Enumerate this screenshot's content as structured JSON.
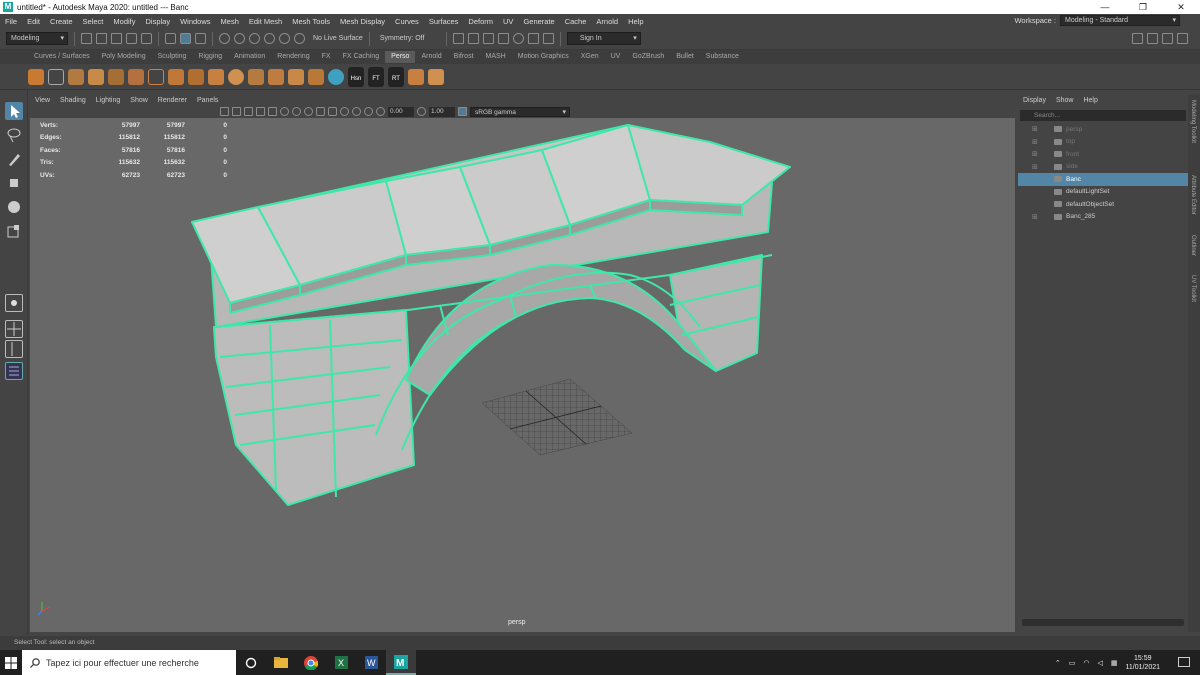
{
  "window": {
    "title": "untitled* - Autodesk Maya 2020: untitled   ---   Banc",
    "minimize": "—",
    "maximize": "❐",
    "close": "✕"
  },
  "menubar": {
    "items": [
      "File",
      "Edit",
      "Create",
      "Select",
      "Modify",
      "Display",
      "Windows",
      "Mesh",
      "Edit Mesh",
      "Mesh Tools",
      "Mesh Display",
      "Curves",
      "Surfaces",
      "Deform",
      "UV",
      "Generate",
      "Cache",
      "Arnold",
      "Help"
    ],
    "workspace_label": "Workspace :",
    "workspace_value": "Modeling - Standard"
  },
  "statusline": {
    "mode": "Modeling",
    "live_surface": "No Live Surface",
    "symmetry": "Symmetry: Off",
    "sign_in": "Sign In"
  },
  "shelf_tabs": {
    "items": [
      "Curves / Surfaces",
      "Poly Modeling",
      "Sculpting",
      "Rigging",
      "Animation",
      "Rendering",
      "FX",
      "FX Caching",
      "Perso",
      "Arnold",
      "Bifrost",
      "MASH",
      "Motion Graphics",
      "XGen",
      "UV",
      "GoZBrush",
      "Bullet",
      "Substance"
    ],
    "active": "Perso"
  },
  "shelf_labels": {
    "a": "Hsn",
    "b": "FT",
    "c": "RT"
  },
  "viewport": {
    "menu": [
      "View",
      "Shading",
      "Lighting",
      "Show",
      "Renderer",
      "Panels"
    ],
    "exposure": "0.00",
    "gamma": "1.00",
    "color_space": "sRGB gamma",
    "camera": "persp"
  },
  "hud": {
    "rows": [
      {
        "label": "Verts:",
        "a": "57997",
        "b": "57997",
        "c": "0"
      },
      {
        "label": "Edges:",
        "a": "115812",
        "b": "115812",
        "c": "0"
      },
      {
        "label": "Faces:",
        "a": "57816",
        "b": "57816",
        "c": "0"
      },
      {
        "label": "Tris:",
        "a": "115632",
        "b": "115632",
        "c": "0"
      },
      {
        "label": "UVs:",
        "a": "62723",
        "b": "62723",
        "c": "0"
      }
    ]
  },
  "outliner": {
    "menu": [
      "Display",
      "Show",
      "Help"
    ],
    "search_placeholder": "Search...",
    "items": [
      {
        "label": "persp",
        "state": "dim"
      },
      {
        "label": "top",
        "state": "dim"
      },
      {
        "label": "front",
        "state": "dim"
      },
      {
        "label": "side",
        "state": "dim"
      },
      {
        "label": "Banc",
        "state": "selected"
      },
      {
        "label": "defaultLightSet",
        "state": "normal"
      },
      {
        "label": "defaultObjectSet",
        "state": "normal"
      },
      {
        "label": "Banc_285",
        "state": "normal"
      }
    ]
  },
  "side_tabs": [
    "Modeling Toolkit",
    "Attribute Editor",
    "Outliner",
    "UV Toolkit"
  ],
  "help_line": "Select Tool: select an object",
  "taskbar": {
    "search_placeholder": "Tapez ici pour effectuer une recherche",
    "time": "15:59",
    "date": "11/01/2021"
  },
  "colors": {
    "wire": "#3ee8a8",
    "mesh": "#c9c9c9",
    "selection": "#5285a6",
    "viewport_bg": "#686868"
  }
}
